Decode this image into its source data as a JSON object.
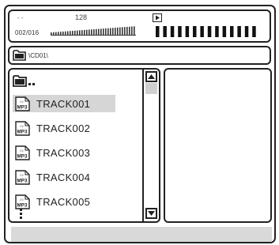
{
  "status": {
    "top_left_text": "- -",
    "bitrate": "128",
    "track_counter": "002/016",
    "play_icon": "play-icon"
  },
  "path": {
    "folder_icon": "folder-icon",
    "current_path": "\\CD01\\"
  },
  "file_list": {
    "parent_entry_icon": "folder-up-icon",
    "items": [
      {
        "label": "TRACK001",
        "icon": "mp3-file-icon",
        "selected": true
      },
      {
        "label": "TRACK002",
        "icon": "mp3-file-icon",
        "selected": false
      },
      {
        "label": "TRACK003",
        "icon": "mp3-file-icon",
        "selected": false
      },
      {
        "label": "TRACK004",
        "icon": "mp3-file-icon",
        "selected": false
      },
      {
        "label": "TRACK005",
        "icon": "mp3-file-icon",
        "selected": false
      }
    ],
    "more_indicator": "more-items-icon"
  },
  "scrollbar": {
    "up_icon": "arrow-up-icon",
    "down_icon": "arrow-down-icon"
  },
  "colors": {
    "border": "#222222",
    "selection": "#d6d6d6",
    "bottom_bar": "#d9d9d9"
  }
}
